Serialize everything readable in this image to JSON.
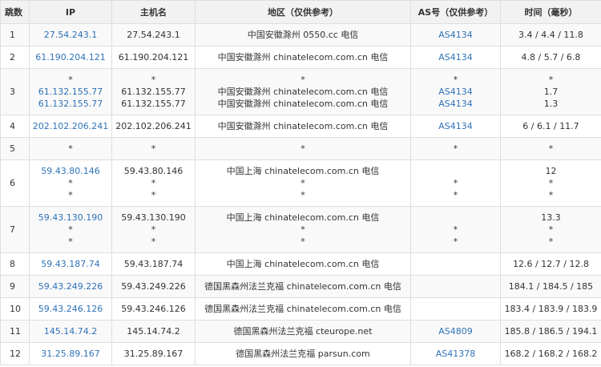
{
  "table": {
    "headers": [
      "跳数",
      "IP",
      "主机名",
      "地区（仅供参考）",
      "AS号（仅供参考）",
      "时间（毫秒）"
    ],
    "rows": [
      {
        "hop": "1",
        "ip": [
          "27.54.243.1"
        ],
        "host": [
          "27.54.243.1"
        ],
        "region": [
          "中国安徽滁州 0550.cc 电信"
        ],
        "as": [
          "AS4134"
        ],
        "time": [
          "3.4 / 4.4 / 11.8"
        ]
      },
      {
        "hop": "2",
        "ip": [
          "61.190.204.121"
        ],
        "host": [
          "61.190.204.121"
        ],
        "region": [
          "中国安徽滁州 chinatelecom.com.cn 电信"
        ],
        "as": [
          "AS4134"
        ],
        "time": [
          "4.8 / 5.7 / 6.8"
        ]
      },
      {
        "hop": "3",
        "ip": [
          "*",
          "61.132.155.77",
          "61.132.155.77"
        ],
        "host": [
          "*",
          "61.132.155.77",
          "61.132.155.77"
        ],
        "region": [
          "*",
          "中国安徽滁州 chinatelecom.com.cn 电信",
          "中国安徽滁州 chinatelecom.com.cn 电信"
        ],
        "as": [
          "*",
          "AS4134",
          "AS4134"
        ],
        "time": [
          "*",
          "1.7",
          "1.3"
        ]
      },
      {
        "hop": "4",
        "ip": [
          "202.102.206.241"
        ],
        "host": [
          "202.102.206.241"
        ],
        "region": [
          "中国安徽滁州 chinatelecom.com.cn 电信"
        ],
        "as": [
          "AS4134"
        ],
        "time": [
          "6 / 6.1 / 11.7"
        ]
      },
      {
        "hop": "5",
        "ip": [
          "*"
        ],
        "host": [
          "*"
        ],
        "region": [
          "*"
        ],
        "as": [
          "*"
        ],
        "time": [
          "*"
        ]
      },
      {
        "hop": "6",
        "ip": [
          "59.43.80.146",
          "*",
          "*"
        ],
        "host": [
          "59.43.80.146",
          "*",
          "*"
        ],
        "region": [
          "中国上海 chinatelecom.com.cn 电信",
          "*",
          "*"
        ],
        "as": [
          "",
          "*",
          "*"
        ],
        "time": [
          "12",
          "*",
          "*"
        ]
      },
      {
        "hop": "7",
        "ip": [
          "59.43.130.190",
          "*",
          "*"
        ],
        "host": [
          "59.43.130.190",
          "*",
          "*"
        ],
        "region": [
          "中国上海 chinatelecom.com.cn 电信",
          "*",
          "*"
        ],
        "as": [
          "",
          "*",
          "*"
        ],
        "time": [
          "13.3",
          "*",
          "*"
        ]
      },
      {
        "hop": "8",
        "ip": [
          "59.43.187.74"
        ],
        "host": [
          "59.43.187.74"
        ],
        "region": [
          "中国上海 chinatelecom.com.cn 电信"
        ],
        "as": [
          ""
        ],
        "time": [
          "12.6 / 12.7 / 12.8"
        ]
      },
      {
        "hop": "9",
        "ip": [
          "59.43.249.226"
        ],
        "host": [
          "59.43.249.226"
        ],
        "region": [
          "德国黑森州法兰克福 chinatelecom.com.cn 电信"
        ],
        "as": [
          ""
        ],
        "time": [
          "184.1 / 184.5 / 185"
        ]
      },
      {
        "hop": "10",
        "ip": [
          "59.43.246.126"
        ],
        "host": [
          "59.43.246.126"
        ],
        "region": [
          "德国黑森州法兰克福 chinatelecom.com.cn 电信"
        ],
        "as": [
          ""
        ],
        "time": [
          "183.4 / 183.9 / 183.9"
        ]
      },
      {
        "hop": "11",
        "ip": [
          "145.14.74.2"
        ],
        "host": [
          "145.14.74.2"
        ],
        "region": [
          "德国黑森州法兰克福 cteurope.net"
        ],
        "as": [
          "AS4809"
        ],
        "time": [
          "185.8 / 186.5 / 194.1"
        ]
      },
      {
        "hop": "12",
        "ip": [
          "31.25.89.167"
        ],
        "host": [
          "31.25.89.167"
        ],
        "region": [
          "德国黑森州法兰克福 parsun.com"
        ],
        "as": [
          "AS41378"
        ],
        "time": [
          "168.2 / 168.2 / 168.2"
        ]
      }
    ]
  },
  "colors": {
    "link": "#2f72b8",
    "header_bg": "#f2f2f2",
    "alt_row_bg": "#f9f9f9",
    "border": "#dedede"
  }
}
